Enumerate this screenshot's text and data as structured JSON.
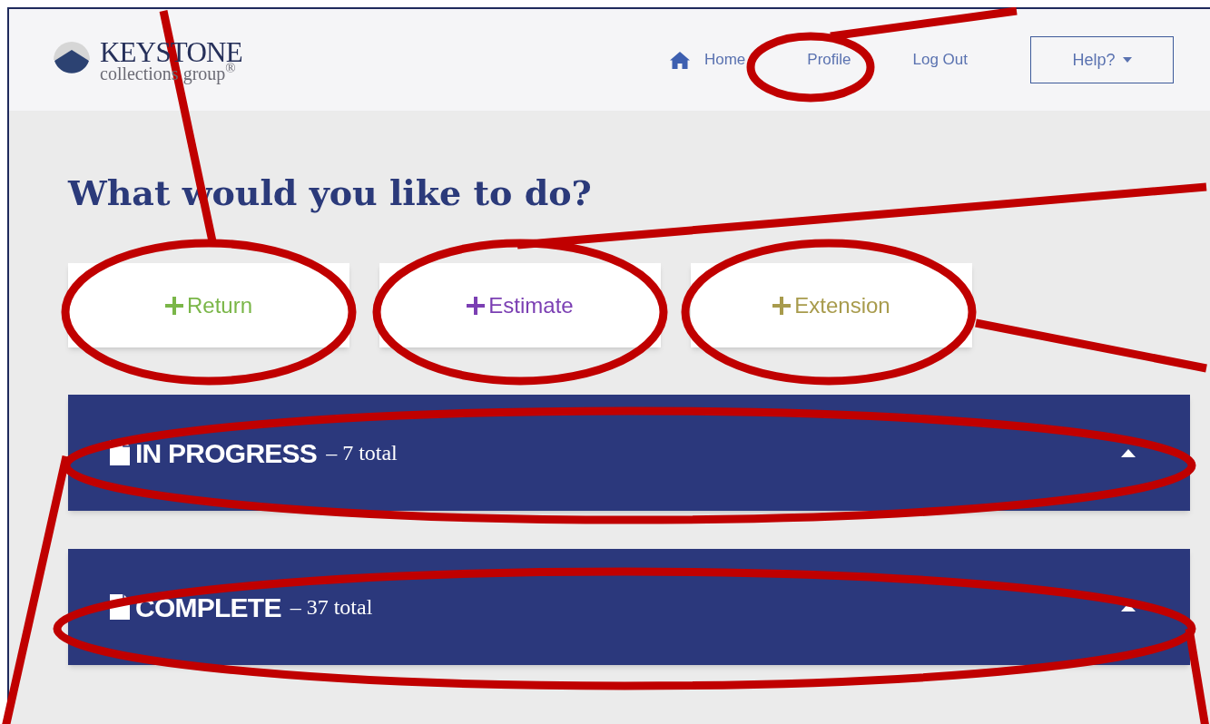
{
  "logo": {
    "name": "KEYSTONE",
    "tagline": "collections group$^{®}$"
  },
  "nav": [
    {
      "label": "Home"
    },
    {
      "label": "Profile"
    },
    {
      "label": "Log Out"
    }
  ],
  "help_button": {
    "label": "Help?"
  },
  "heading": "What would you like to do?",
  "actions": [
    {
      "label": "Return",
      "color": "#7ab648"
    },
    {
      "label": "Estimate",
      "color": "#7b3fb3"
    },
    {
      "label": "Extension",
      "color": "#a89b4c"
    }
  ],
  "sections": [
    {
      "title": "IN PROGRESS",
      "count": "– 7 total",
      "expanded": true
    },
    {
      "title": "COMPLETE",
      "count": "– 37 total",
      "expanded": true
    }
  ]
}
